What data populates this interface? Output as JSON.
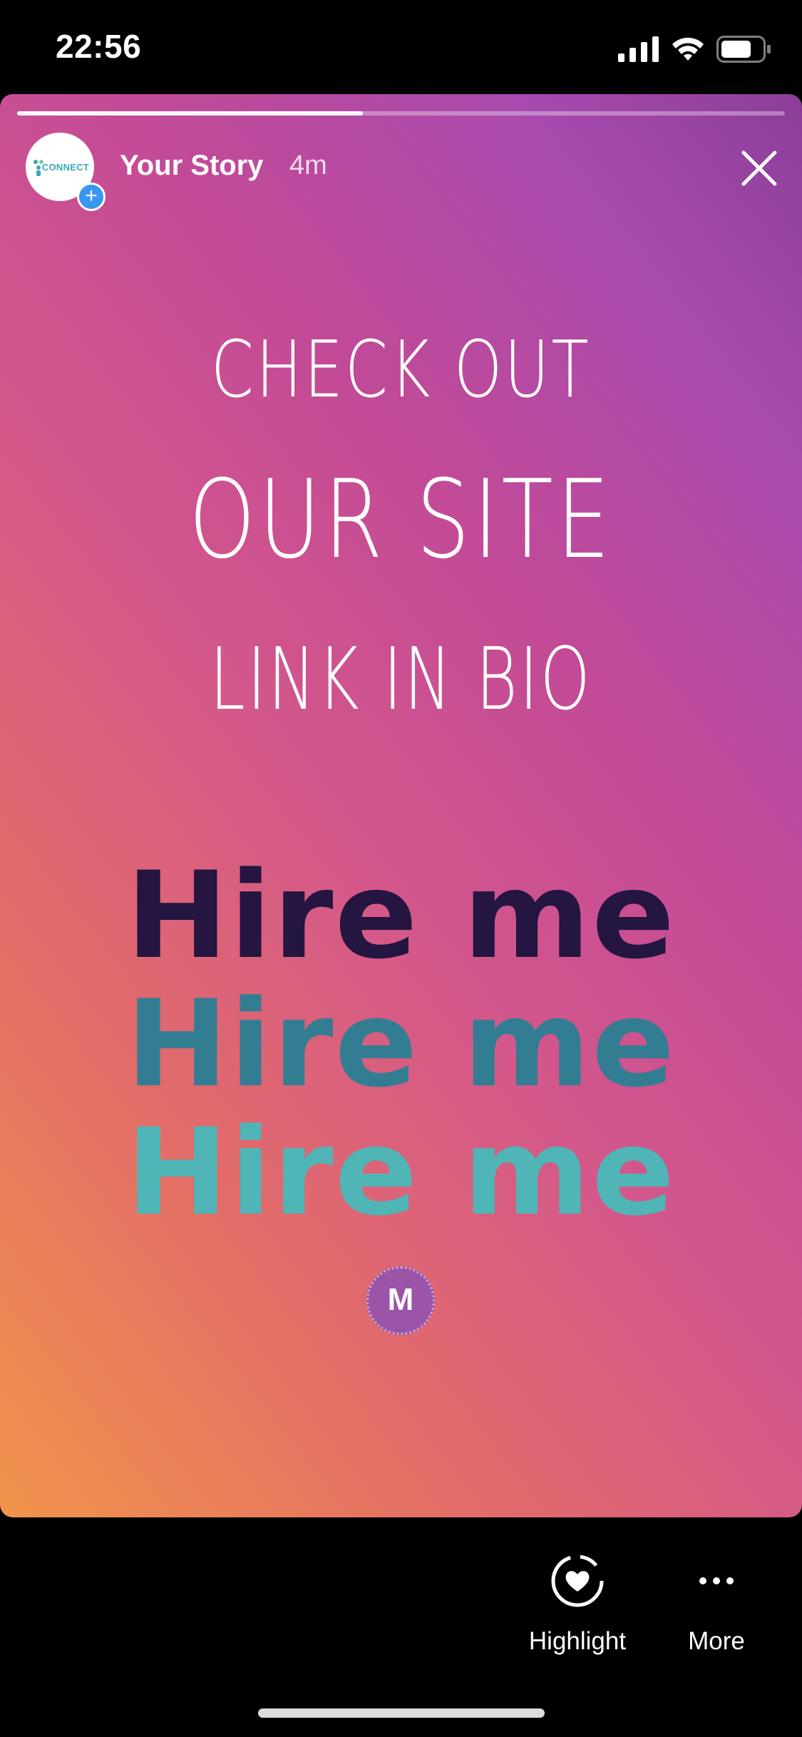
{
  "status_bar": {
    "time": "22:56",
    "icons": [
      "signal-icon",
      "wifi-icon",
      "battery-icon"
    ],
    "battery_level": 0.7
  },
  "story": {
    "progress": 0.45,
    "owner": "Your Story",
    "time_ago": "4m",
    "avatar_text": "CONNECT",
    "headline": {
      "line1": "CHECK OUT",
      "line2": "OUR SITE",
      "line3": "LINK IN BIO"
    },
    "hire_lines": [
      "Hire me",
      "Hire me",
      "Hire me"
    ],
    "sticker_letter": "M",
    "colors": {
      "gradient_start": "#f2944b",
      "gradient_mid": "#d4588a",
      "gradient_end": "#8b3e98",
      "hire_1": "#241541",
      "hire_2": "#337d93",
      "hire_3": "#4fb5b6",
      "add_badge": "#3897f0"
    }
  },
  "bottom_bar": {
    "highlight_label": "Highlight",
    "more_label": "More"
  }
}
